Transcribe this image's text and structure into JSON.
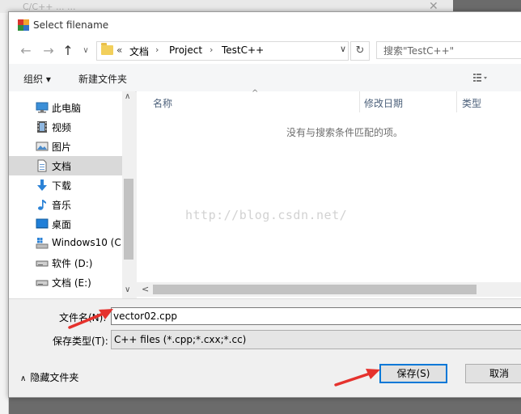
{
  "background_window": {
    "title": "C/C++ ... ...",
    "close_glyph": "✕"
  },
  "dialog": {
    "title": "Select filename"
  },
  "nav": {
    "back": "←",
    "forward": "→",
    "up": "↑"
  },
  "address": {
    "chevron": "«",
    "crumbs": [
      "文档",
      "Project",
      "TestC++"
    ],
    "sep": "›",
    "dropdown": "∨",
    "refresh": "↻"
  },
  "search": {
    "placeholder": "搜索\"TestC++\""
  },
  "toolbar": {
    "organize": "组织 ▾",
    "new_folder": "新建文件夹"
  },
  "sidebar": {
    "items": [
      {
        "label": "此电脑",
        "icon": "computer-icon"
      },
      {
        "label": "视频",
        "icon": "video-icon"
      },
      {
        "label": "图片",
        "icon": "picture-icon"
      },
      {
        "label": "文档",
        "icon": "document-icon",
        "selected": true
      },
      {
        "label": "下载",
        "icon": "download-icon"
      },
      {
        "label": "音乐",
        "icon": "music-icon"
      },
      {
        "label": "桌面",
        "icon": "desktop-icon"
      },
      {
        "label": "Windows10 (C:",
        "icon": "windows-drive-icon"
      },
      {
        "label": "软件 (D:)",
        "icon": "drive-icon"
      },
      {
        "label": "文档 (E:)",
        "icon": "drive-icon"
      }
    ],
    "scroll_up": "∧",
    "scroll_down": "∨"
  },
  "filelist": {
    "columns": [
      "名称",
      "修改日期",
      "类型"
    ],
    "sort_caret": "^",
    "empty_message": "没有与搜索条件匹配的项。",
    "watermark": "http://blog.csdn.net/",
    "scroll_left": "<"
  },
  "form": {
    "filename_label": "文件名(N):",
    "filename_value": "vector02.cpp",
    "filetype_label": "保存类型(T):",
    "filetype_value": "C++ files (*.cpp;*.cxx;*.cc)"
  },
  "footer": {
    "hide_folders": "隐藏文件夹",
    "hide_caret": "∧",
    "save": "保存(S)",
    "cancel": "取消"
  },
  "colors": {
    "accent": "#0078d7",
    "annotation_arrow": "#e5322d",
    "folder": "#f2cf5b"
  }
}
